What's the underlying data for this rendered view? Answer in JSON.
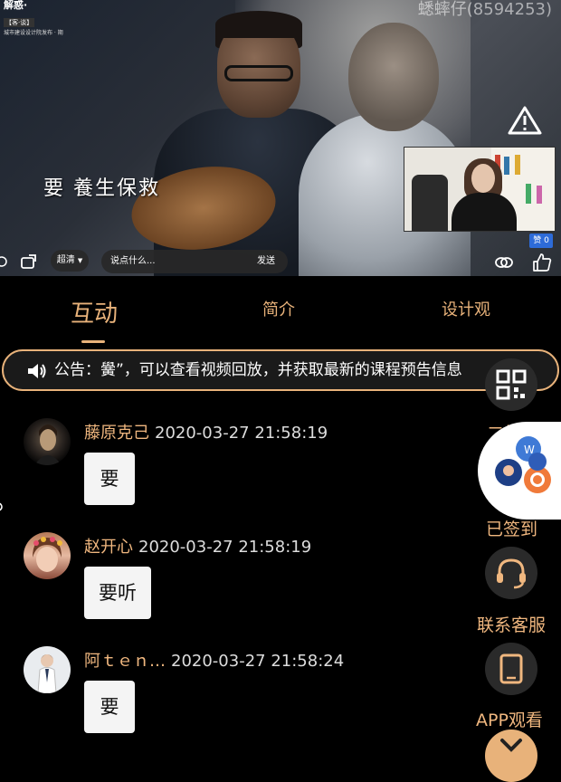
{
  "video": {
    "logo_line1": "解惑·",
    "logo_badge": "【客·谈】",
    "logo_line3": "城市建设设计院发布 · 期",
    "watermark": "蟋蟀仔(8594253)",
    "subtitle": "要 養生保救",
    "like_count": "赞 0",
    "quality_label": "超清",
    "chat_placeholder": "说点什么...",
    "send_label": "发送"
  },
  "tabs": [
    {
      "label": "互动",
      "active": true
    },
    {
      "label": "简介",
      "active": false
    },
    {
      "label": "设计观",
      "active": false
    }
  ],
  "notice": {
    "text": "公告：黌”，可以查看视频回放，并获取最新的课程预告信息"
  },
  "messages": [
    {
      "name": "藤原克己",
      "time": "2020-03-27 21:58:19",
      "content": "要"
    },
    {
      "name": "赵开心",
      "time": "2020-03-27 21:58:19",
      "content": "要听"
    },
    {
      "name": "阿ｔｅｎ…",
      "time": "2020-03-27 21:58:24",
      "content": "要"
    }
  ],
  "side_menu": {
    "qr_label": "二维码",
    "signed_label": "已签到",
    "service_label": "联系客服",
    "app_label": "APP观看"
  },
  "colors": {
    "accent": "#e8b27a",
    "name": "#f0b77f",
    "bubble": "#f4f4f4",
    "background": "#000000"
  }
}
